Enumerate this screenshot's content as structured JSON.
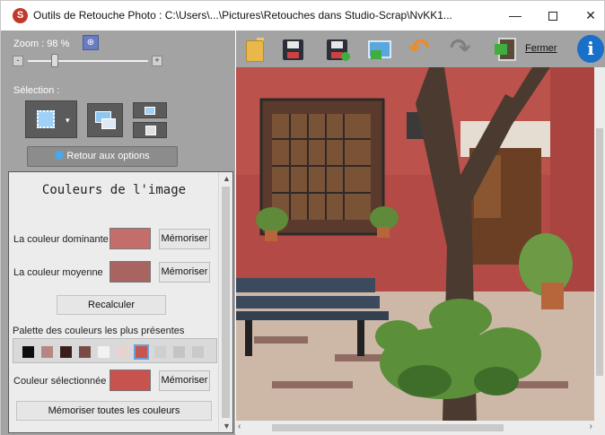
{
  "window": {
    "title": "Outils de Retouche Photo : C:\\Users\\...\\Pictures\\Retouches dans Studio-Scrap\\NvKK1...",
    "minimize_glyph": "—",
    "close_glyph": "✕"
  },
  "zoom": {
    "label": "Zoom : 98 %",
    "value_percent": 98,
    "minus": "-",
    "plus": "+",
    "button_icon": "zoom-plus-icon"
  },
  "selection": {
    "label": "Sélection :"
  },
  "retour_button": {
    "label": "Retour aux options"
  },
  "colors": {
    "title": "Couleurs de l'image",
    "dominant": {
      "label": "La couleur dominante",
      "color": "#c46e6b",
      "button": "Mémoriser"
    },
    "average": {
      "label": "La couleur moyenne",
      "color": "#a86460",
      "button": "Mémoriser"
    },
    "recalc_button": "Recalculer",
    "palette_label": "Palette des couleurs les plus présentes",
    "palette": [
      {
        "color": "#0e0e0e"
      },
      {
        "color": "#b88682"
      },
      {
        "color": "#3a1e1c"
      },
      {
        "color": "#7a4a46"
      },
      {
        "color": "#f2f2f2"
      },
      {
        "color": "#e8d2cf"
      },
      {
        "color": "#c65450",
        "selected": true
      },
      {
        "color": "#cfcfcf"
      },
      {
        "color": "#c4c4c4"
      },
      {
        "color": "#c9c9c9"
      }
    ],
    "selected": {
      "label": "Couleur sélectionnée",
      "color": "#c8524e",
      "button": "Mémoriser"
    },
    "memorize_all": "Mémoriser toutes les couleurs"
  },
  "toolbar": {
    "open_icon": "folder-icon",
    "save_icon": "save-icon",
    "save_as_icon": "save-as-icon",
    "export_icon": "export-image-icon",
    "undo_icon": "undo-icon",
    "undo_glyph": "↶",
    "redo_icon": "redo-icon",
    "redo_glyph": "↷",
    "close_label": "Fermer",
    "info_label": "i"
  }
}
